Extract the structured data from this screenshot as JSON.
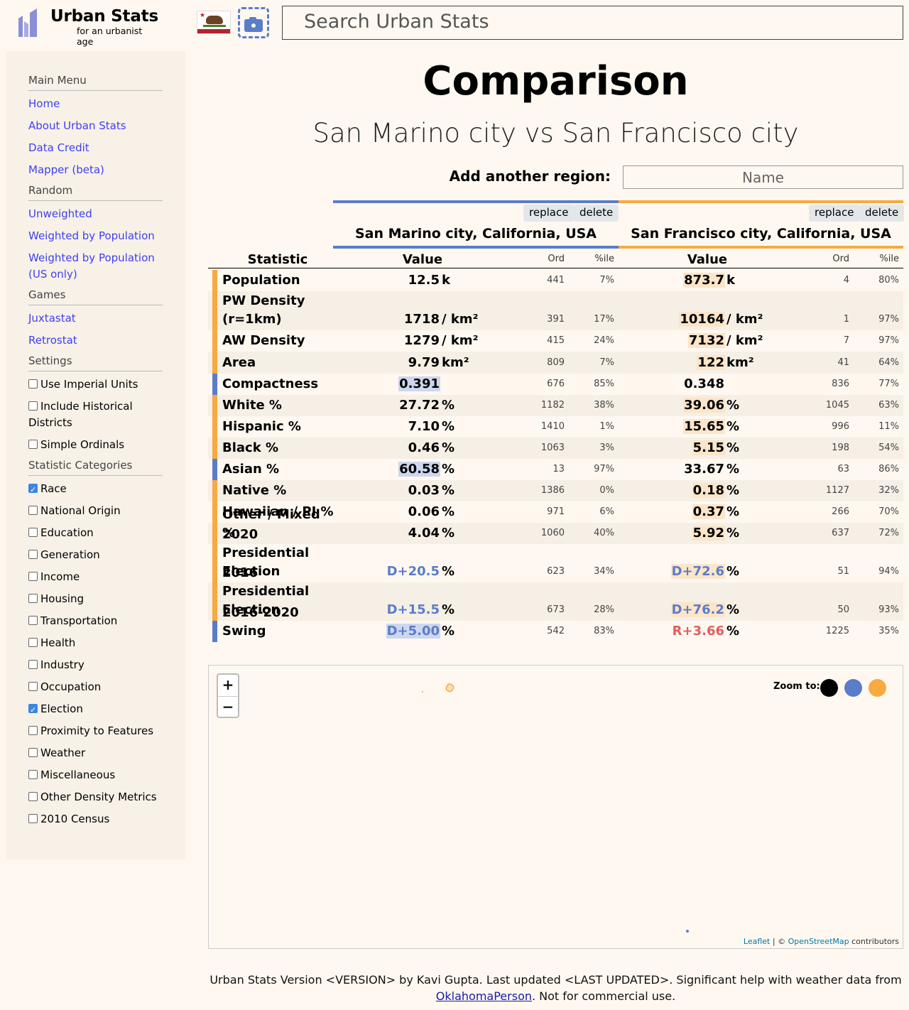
{
  "header": {
    "logo_title": "Urban Stats",
    "logo_subtitle": "for an urbanist age",
    "search_placeholder": "Search Urban Stats"
  },
  "sidebar": {
    "main_menu": {
      "heading": "Main Menu",
      "items": [
        "Home",
        "About Urban Stats",
        "Data Credit",
        "Mapper (beta)"
      ]
    },
    "random": {
      "heading": "Random",
      "items": [
        "Unweighted",
        "Weighted by Population",
        "Weighted by Population (US only)"
      ]
    },
    "games": {
      "heading": "Games",
      "items": [
        "Juxtastat",
        "Retrostat"
      ]
    },
    "settings": {
      "heading": "Settings",
      "items": [
        {
          "label": "Use Imperial Units",
          "checked": false
        },
        {
          "label": "Include Historical Districts",
          "checked": false
        },
        {
          "label": "Simple Ordinals",
          "checked": false
        }
      ]
    },
    "categories": {
      "heading": "Statistic Categories",
      "items": [
        {
          "label": "Race",
          "checked": true
        },
        {
          "label": "National Origin",
          "checked": false
        },
        {
          "label": "Education",
          "checked": false
        },
        {
          "label": "Generation",
          "checked": false
        },
        {
          "label": "Income",
          "checked": false
        },
        {
          "label": "Housing",
          "checked": false
        },
        {
          "label": "Transportation",
          "checked": false
        },
        {
          "label": "Health",
          "checked": false
        },
        {
          "label": "Industry",
          "checked": false
        },
        {
          "label": "Occupation",
          "checked": false
        },
        {
          "label": "Election",
          "checked": true
        },
        {
          "label": "Proximity to Features",
          "checked": false
        },
        {
          "label": "Weather",
          "checked": false
        },
        {
          "label": "Miscellaneous",
          "checked": false
        },
        {
          "label": "Other Density Metrics",
          "checked": false
        },
        {
          "label": "2010 Census",
          "checked": false
        }
      ]
    }
  },
  "main": {
    "title": "Comparison",
    "subtitle": "San Marino city vs San Francisco city",
    "add_region_label": "Add another region:",
    "add_region_placeholder": "Name",
    "replace_label": "replace",
    "delete_label": "delete",
    "colors": {
      "region1": "#5a7dc9",
      "region2": "#f7aa41"
    },
    "regions": [
      "San Marino city, California, USA",
      "San Francisco city, California, USA"
    ],
    "columns": {
      "statistic": "Statistic",
      "value": "Value",
      "ord": "Ord",
      "pct": "%ile"
    }
  },
  "table": [
    {
      "stat": "Population",
      "winner": 2,
      "r1": {
        "num": "12.5",
        "unit": "k",
        "ord": "441",
        "pct": "7%"
      },
      "r2": {
        "num": "873.7",
        "unit": "k",
        "ord": "4",
        "pct": "80%"
      }
    },
    {
      "stat": "PW Density (r=1km)",
      "winner": 2,
      "r1": {
        "num": "1718",
        "unit": "/ km²",
        "ord": "391",
        "pct": "17%"
      },
      "r2": {
        "num": "10164",
        "unit": "/ km²",
        "ord": "1",
        "pct": "97%"
      }
    },
    {
      "stat": "AW Density",
      "winner": 2,
      "r1": {
        "num": "1279",
        "unit": "/ km²",
        "ord": "415",
        "pct": "24%"
      },
      "r2": {
        "num": "7132",
        "unit": "/ km²",
        "ord": "7",
        "pct": "97%"
      }
    },
    {
      "stat": "Area",
      "winner": 2,
      "r1": {
        "num": "9.79",
        "unit": "km²",
        "ord": "809",
        "pct": "7%"
      },
      "r2": {
        "num": "122",
        "unit": "km²",
        "ord": "41",
        "pct": "64%"
      }
    },
    {
      "stat": "Compactness",
      "winner": 1,
      "r1": {
        "num": "0.391",
        "unit": "",
        "ord": "676",
        "pct": "85%"
      },
      "r2": {
        "num": "0.348",
        "unit": "",
        "ord": "836",
        "pct": "77%"
      }
    },
    {
      "stat": "White %",
      "winner": 2,
      "r1": {
        "num": "27.72",
        "unit": "%",
        "ord": "1182",
        "pct": "38%"
      },
      "r2": {
        "num": "39.06",
        "unit": "%",
        "ord": "1045",
        "pct": "63%"
      }
    },
    {
      "stat": "Hispanic %",
      "winner": 2,
      "r1": {
        "num": "7.10",
        "unit": "%",
        "ord": "1410",
        "pct": "1%"
      },
      "r2": {
        "num": "15.65",
        "unit": "%",
        "ord": "996",
        "pct": "11%"
      }
    },
    {
      "stat": "Black %",
      "winner": 2,
      "r1": {
        "num": "0.46",
        "unit": "%",
        "ord": "1063",
        "pct": "3%"
      },
      "r2": {
        "num": "5.15",
        "unit": "%",
        "ord": "198",
        "pct": "54%"
      }
    },
    {
      "stat": "Asian %",
      "winner": 1,
      "r1": {
        "num": "60.58",
        "unit": "%",
        "ord": "13",
        "pct": "97%"
      },
      "r2": {
        "num": "33.67",
        "unit": "%",
        "ord": "63",
        "pct": "86%"
      }
    },
    {
      "stat": "Native %",
      "winner": 2,
      "r1": {
        "num": "0.03",
        "unit": "%",
        "ord": "1386",
        "pct": "0%"
      },
      "r2": {
        "num": "0.18",
        "unit": "%",
        "ord": "1127",
        "pct": "32%"
      }
    },
    {
      "stat": "Hawaiian / PI %",
      "winner": 2,
      "r1": {
        "num": "0.06",
        "unit": "%",
        "ord": "971",
        "pct": "6%"
      },
      "r2": {
        "num": "0.37",
        "unit": "%",
        "ord": "266",
        "pct": "70%"
      }
    },
    {
      "stat": "Other / Mixed %",
      "winner": 2,
      "r1": {
        "num": "4.04",
        "unit": "%",
        "ord": "1060",
        "pct": "40%"
      },
      "r2": {
        "num": "5.92",
        "unit": "%",
        "ord": "637",
        "pct": "72%"
      }
    },
    {
      "stat": "2020 Presidential Election",
      "winner": 2,
      "r1": {
        "num": "D+20.5",
        "unit": "%",
        "ord": "623",
        "pct": "34%",
        "party": "dem"
      },
      "r2": {
        "num": "D+72.6",
        "unit": "%",
        "ord": "51",
        "pct": "94%",
        "party": "dem"
      }
    },
    {
      "stat": "2016 Presidential Election",
      "winner": 2,
      "r1": {
        "num": "D+15.5",
        "unit": "%",
        "ord": "673",
        "pct": "28%",
        "party": "dem"
      },
      "r2": {
        "num": "D+76.2",
        "unit": "%",
        "ord": "50",
        "pct": "93%",
        "party": "dem"
      }
    },
    {
      "stat": "2016-2020 Swing",
      "winner": 1,
      "r1": {
        "num": "D+5.00",
        "unit": "%",
        "ord": "542",
        "pct": "83%",
        "party": "dem"
      },
      "r2": {
        "num": "R+3.66",
        "unit": "%",
        "ord": "1225",
        "pct": "35%",
        "party": "rep"
      }
    }
  ],
  "map": {
    "zoom_in": "+",
    "zoom_out": "−",
    "zoom_to_label": "Zoom to:",
    "zoom_colors": [
      "#000000",
      "#5a7dc9",
      "#f7aa41"
    ],
    "attribution_leaflet": "Leaflet",
    "attribution_sep": " | © ",
    "attribution_osm": "OpenStreetMap",
    "attribution_tail": " contributors"
  },
  "footer": {
    "text": "Urban Stats Version <VERSION> by Kavi Gupta. Last updated <LAST UPDATED>. Significant help with weather data from ",
    "link": "OklahomaPerson",
    "tail": ". Not for commercial use."
  }
}
